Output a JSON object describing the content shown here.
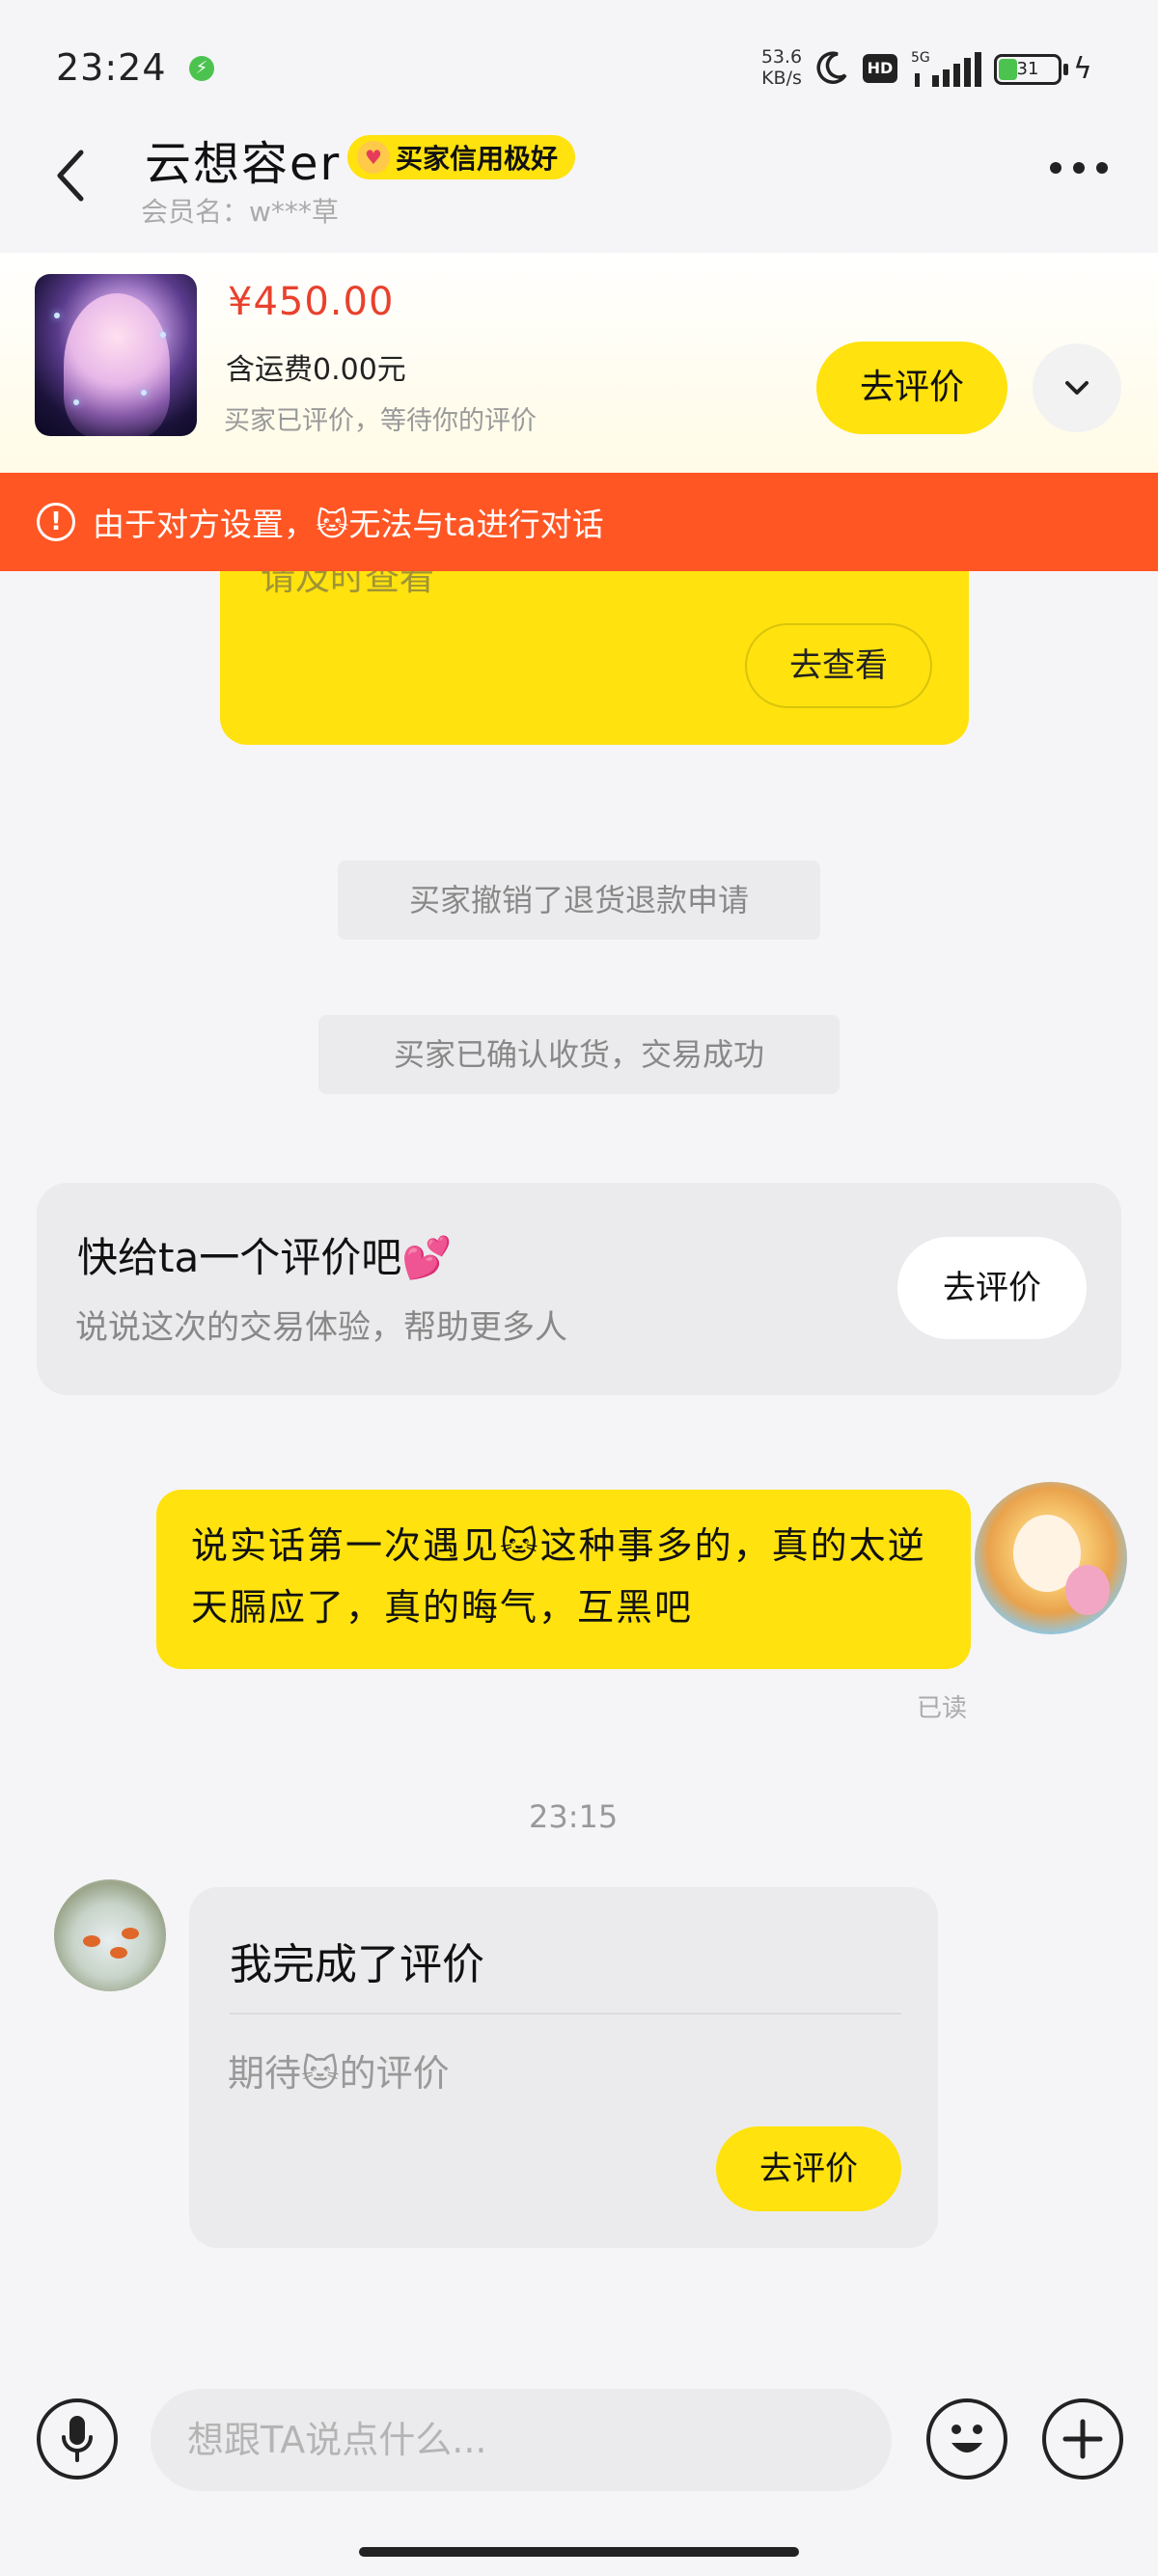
{
  "status_bar": {
    "time": "23:24",
    "notification_icon": "green-badge-icon",
    "net_speed_value": "53.6",
    "net_speed_unit": "KB/s",
    "hd_label": "HD",
    "network_label": "5G",
    "battery_level": "31"
  },
  "header": {
    "title": "云想容er",
    "credit_badge": "买家信用极好",
    "member_name": "会员名：w***草"
  },
  "product": {
    "price": "¥450.00",
    "shipping": "含运费0.00元",
    "status": "买家已评价，等待你的评价",
    "rate_button": "去评价"
  },
  "banner": {
    "text": "由于对方设置，🐱无法与ta进行对话",
    "color": "#ff5624"
  },
  "messages": {
    "card_partial_text": "请及时查看",
    "view_button": "去查看",
    "system_1": "买家撤销了退货退款申请",
    "system_2": "买家已确认收货，交易成功",
    "rate_prompt_title": "快给ta一个评价吧💕",
    "rate_prompt_subtitle": "说说这次的交易体验，帮助更多人",
    "rate_prompt_button": "去评价",
    "my_message": "说实话第一次遇见🐱这种事多的，真的太逆天膈应了，真的晦气，互黑吧",
    "read_status": "已读",
    "timestamp": "23:15",
    "other_card_title": "我完成了评价",
    "other_card_subtitle": "期待🐱的评价",
    "other_card_button": "去评价"
  },
  "input_bar": {
    "placeholder": "想跟TA说点什么..."
  },
  "colors": {
    "accent_yellow": "#ffe20e",
    "price_red": "#e8412d",
    "background": "#f5f5f7"
  }
}
